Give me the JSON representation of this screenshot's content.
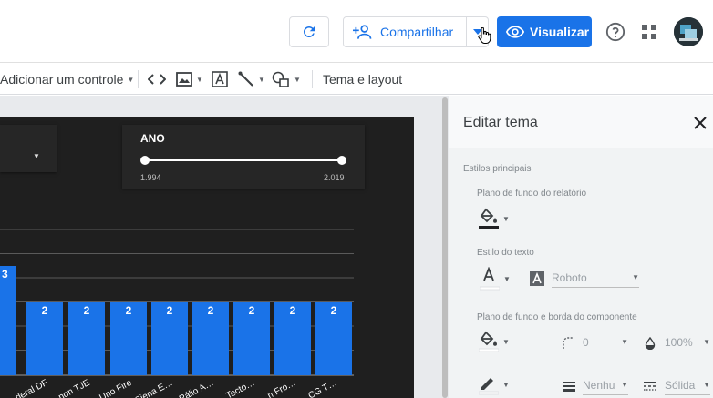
{
  "header": {
    "share_label": "Compartilhar",
    "view_label": "Visualizar"
  },
  "toolbar": {
    "add_control_label": "Adicionar um controle",
    "theme_layout_label": "Tema e layout"
  },
  "report": {
    "year_filter": {
      "label": "ANO",
      "min": "1.994",
      "max": "2.019",
      "selected_start": 1994,
      "selected_end": 2019
    }
  },
  "chart_data": {
    "type": "bar",
    "categories": [
      "…",
      "…deral DF",
      "…non TJE",
      "…Uno Fire",
      "…Siena E…",
      "…Pálio A…",
      "…Tecto…",
      "…n Fro…",
      "…CG T…"
    ],
    "values": [
      3,
      2,
      2,
      2,
      2,
      2,
      2,
      2,
      2
    ],
    "data_labels": [
      "3",
      "2",
      "2",
      "2",
      "2",
      "2",
      "2",
      "2",
      "2"
    ],
    "bar_color": "#1a73e8",
    "background_color": "#1f1f1f",
    "grid": true
  },
  "theme_panel": {
    "title": "Editar tema",
    "section_main": "Estilos principais",
    "report_bg_label": "Plano de fundo do relatório",
    "text_style_label": "Estilo do texto",
    "font_value": "Roboto",
    "component_bg_label": "Plano de fundo e borda do componente",
    "border_radius_value": "0",
    "opacity_value": "100%",
    "border_weight_value": "Nenhu",
    "border_style_value": "Sólida"
  },
  "colors": {
    "accent": "#1a73e8",
    "report_bg": "#1f1f1f",
    "panel_bg": "#f1f3f4"
  }
}
